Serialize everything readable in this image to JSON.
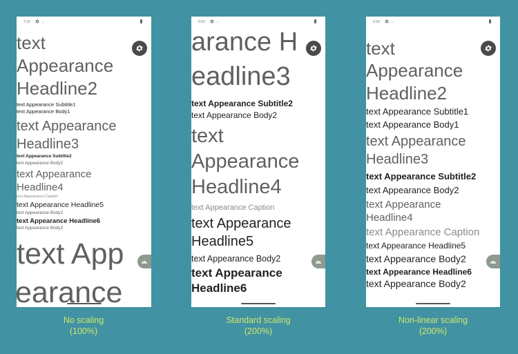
{
  "colors": {
    "background": "#4192a2",
    "caption_text": "#cfe86a",
    "fab": "#4a4a4a",
    "side_button": "#8e9a8f"
  },
  "panels": [
    {
      "status_time": "7:16",
      "caption_title": "No scaling",
      "caption_value": "(100%)",
      "lines": [
        "text",
        "Appearance",
        "Headline2",
        "text Appearance Subtitle1",
        "text Appearance Body1",
        "text Appearance",
        "Headline3",
        "text Appearance Subtitle2",
        "text Appearance Body2",
        "text Appearance",
        "Headline4",
        "text Appearance Caption",
        "text Appearance Headline5",
        "text Appearance Body2",
        "text Appearance Headline6",
        "text Appearance Body2",
        "text App",
        "earance"
      ]
    },
    {
      "status_time": "6:59",
      "caption_title": "Standard scaling",
      "caption_value": "(200%)",
      "lines": [
        "arance H",
        "eadline3",
        "text Appearance Subtitle2",
        "text Appearance Body2",
        "text",
        "Appearance",
        "Headline4",
        "text Appearance Caption",
        "text Appearance",
        "Headline5",
        "text Appearance Body2",
        "text Appearance",
        "Headline6"
      ]
    },
    {
      "status_time": "6:59",
      "caption_title": "Non-linear scaling",
      "caption_value": "(200%)",
      "lines": [
        "text",
        "Appearance",
        "Headline2",
        "text Appearance Subtitle1",
        "text Appearance Body1",
        "text Appearance",
        "Headline3",
        "text Appearance Subtitle2",
        "text Appearance Body2",
        "text Appearance",
        "Headline4",
        "text Appearance Caption",
        "text Appearance Headline5",
        "text Appearance Body2",
        "text Appearance Headline6",
        "text Appearance Body2"
      ]
    }
  ],
  "icons": {
    "settings_fab": "gear-icon",
    "side_button": "android-icon",
    "status_settings": "gear-icon",
    "battery": "battery-icon"
  }
}
